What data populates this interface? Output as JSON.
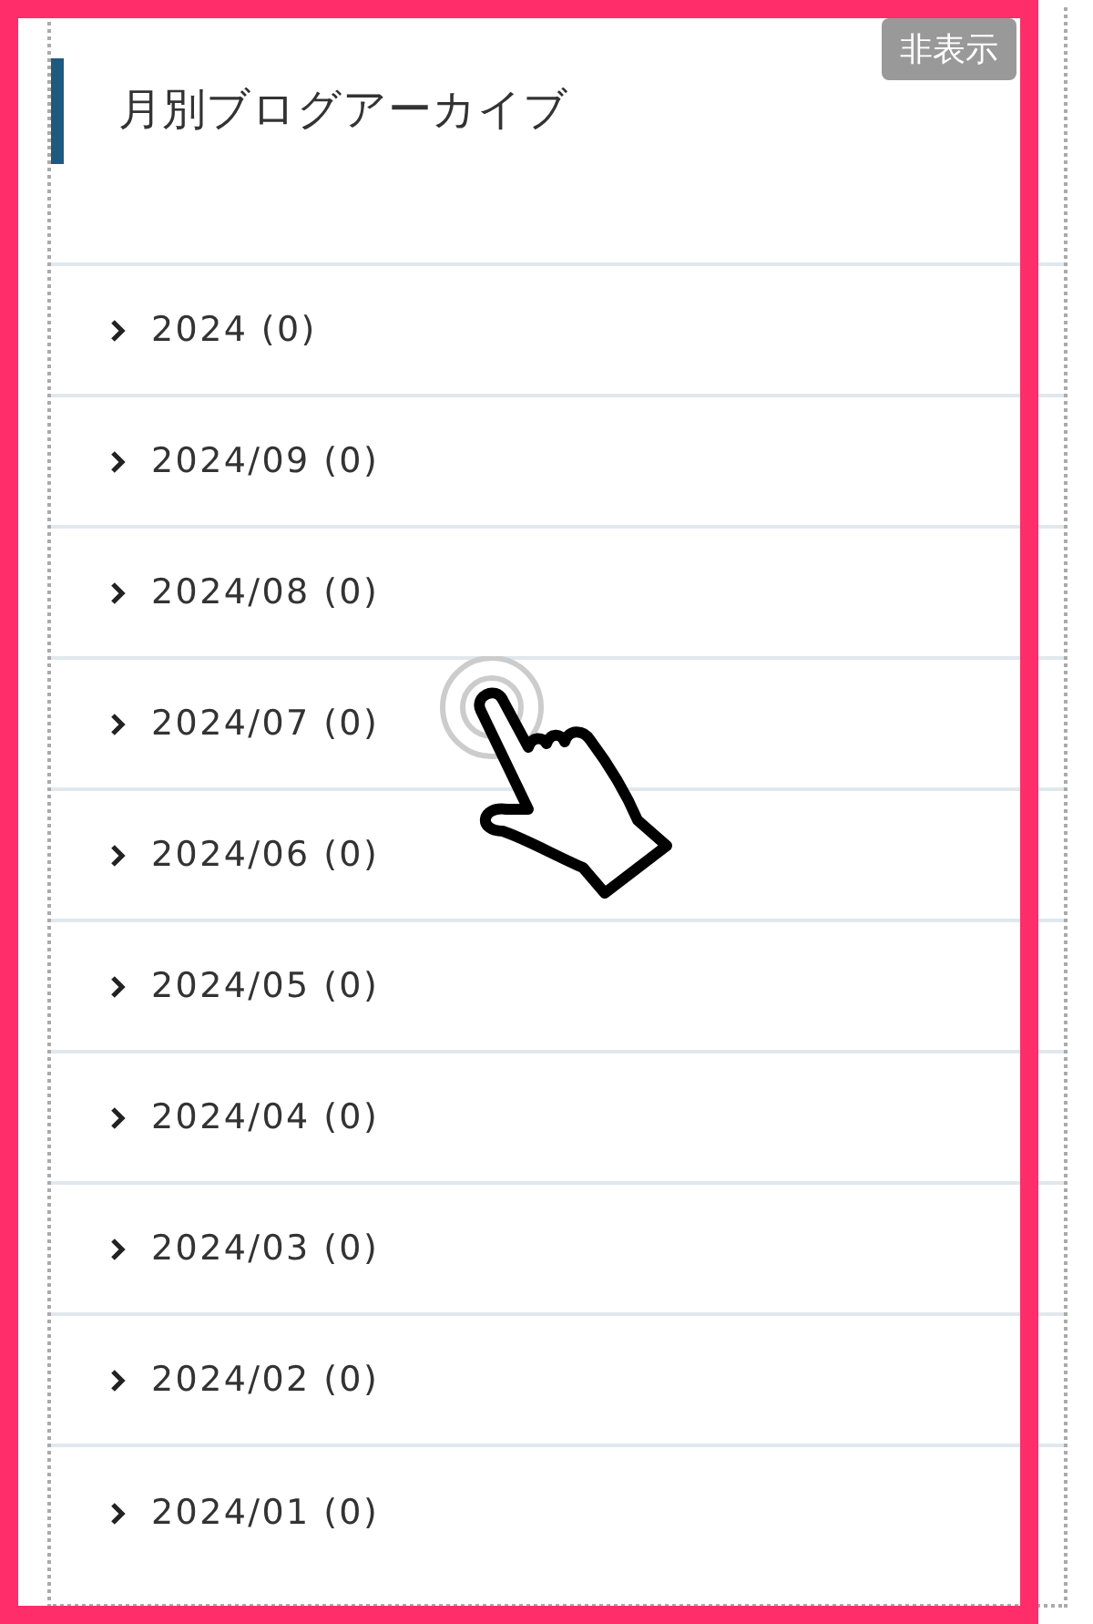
{
  "widget": {
    "title": "月別ブログアーカイブ",
    "hide_button": "非表示"
  },
  "archive_items": [
    "2024 (0)",
    "2024/09 (0)",
    "2024/08 (0)",
    "2024/07 (0)",
    "2024/06 (0)",
    "2024/05 (0)",
    "2024/04 (0)",
    "2024/03 (0)",
    "2024/02 (0)",
    "2024/01 (0)"
  ]
}
